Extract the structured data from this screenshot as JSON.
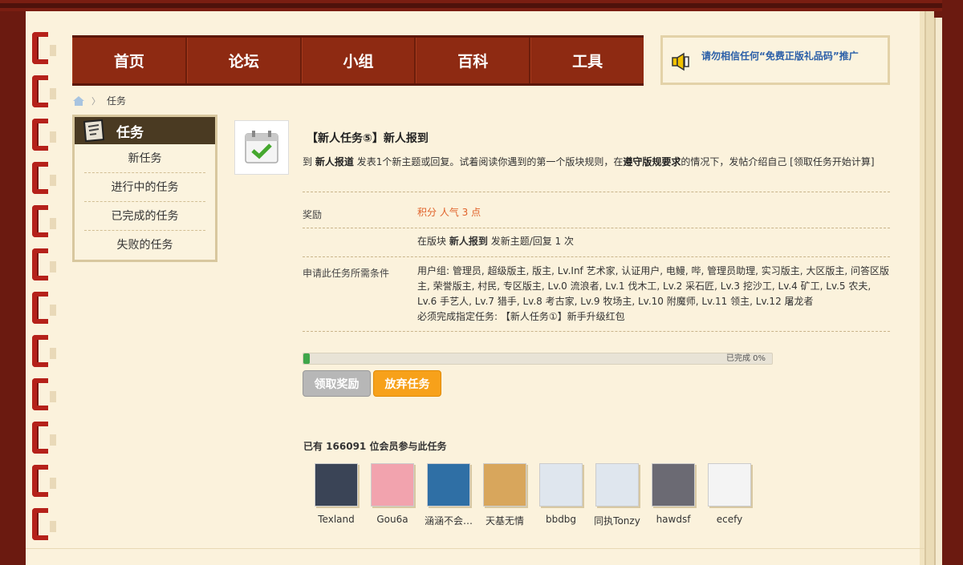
{
  "nav": {
    "items": [
      "首页",
      "论坛",
      "小组",
      "百科",
      "工具"
    ]
  },
  "notice": {
    "text": "请勿相信任何“免费正版礼品码”推广"
  },
  "breadcrumb": {
    "current": "任务"
  },
  "sidebar": {
    "title": "任务",
    "items": [
      "新任务",
      "进行中的任务",
      "已完成的任务",
      "失败的任务"
    ]
  },
  "task": {
    "title": "【新人任务⑤】新人报到",
    "desc_prefix": "到",
    "desc_forum": "新人报道",
    "desc_mid": "发表1个新主题或回复。试着阅读你遇到的第一个版块规则，在",
    "desc_rule": "遵守版规要求",
    "desc_suffix": "的情况下，发帖介绍自己 [领取任务开始计算]",
    "reward_label": "奖励",
    "reward_value": "积分 人气 3 点",
    "requirement_prefix": "在版块",
    "requirement_forum": "新人报到",
    "requirement_suffix": "发新主题/回复 1 次",
    "conditions_label": "申请此任务所需条件",
    "conditions_groups": "用户组: 管理员, 超级版主, 版主, Lv.Inf 艺术家, 认证用户, 电鳗, 哔, 管理员助理, 实习版主, 大区版主, 问答区版主, 荣誉版主, 村民, 专区版主, Lv.0 流浪者, Lv.1 伐木工, Lv.2 采石匠, Lv.3 挖沙工, Lv.4 矿工, Lv.5 农夫, Lv.6 手艺人, Lv.7 猎手, Lv.8 考古家, Lv.9 牧场主, Lv.10 附魔师, Lv.11 领主, Lv.12 屠龙者",
    "conditions_prereq": "必须完成指定任务: 【新人任务①】新手升级红包",
    "progress_text": "已完成 0%",
    "progress_value": 0.0,
    "claim_button": "领取奖励",
    "abandon_button": "放弃任务"
  },
  "members": {
    "title": "已有 166091 位会员参与此任务",
    "list": [
      {
        "name": "Texland",
        "color": "#3a4456"
      },
      {
        "name": "Gou6a",
        "color": "#f2a3ae"
      },
      {
        "name": "涵涵不会…",
        "color": "#2f6fa5"
      },
      {
        "name": "天基无情",
        "color": "#d8a65c"
      },
      {
        "name": "bbdbg",
        "color": "#dfe6ee"
      },
      {
        "name": "同执Tonzy",
        "color": "#dfe6ee"
      },
      {
        "name": "hawdsf",
        "color": "#6b6a73"
      },
      {
        "name": "ecefy",
        "color": "#f4f4f4"
      }
    ]
  },
  "colors": {
    "nav_bg": "#8e2a12",
    "reward": "#e0622a",
    "abandon_button": "#f7a11a",
    "progress_fill": "#3fa64a"
  }
}
